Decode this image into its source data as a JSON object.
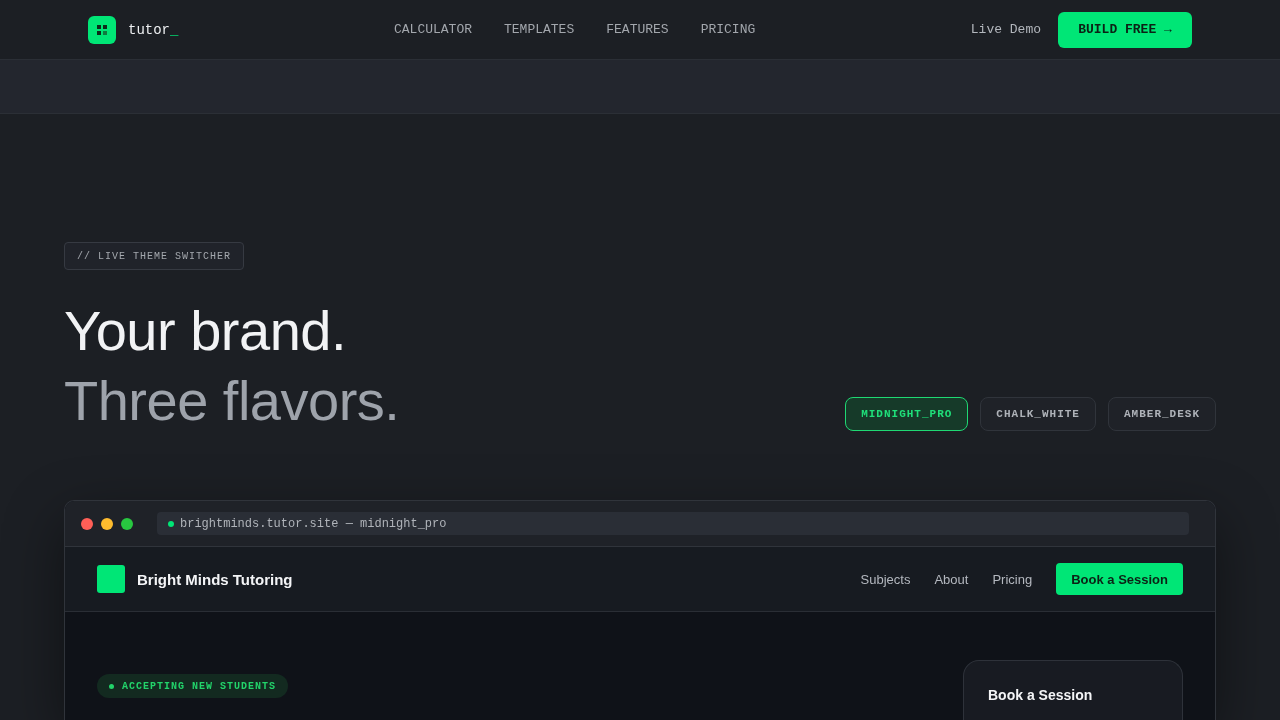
{
  "nav": {
    "brand": {
      "name": "tutor",
      "cursor": "_"
    },
    "links": [
      "CALCULATOR",
      "TEMPLATES",
      "FEATURES",
      "PRICING"
    ],
    "demo_link": "Live Demo",
    "cta": "BUILD FREE →"
  },
  "hero": {
    "eyebrow": "// LIVE THEME SWITCHER",
    "headline": "Your brand.",
    "subheadline": "Three flavors.",
    "themes": [
      {
        "label": "MIDNIGHT_PRO",
        "selected": true
      },
      {
        "label": "CHALK_WHITE",
        "selected": false
      },
      {
        "label": "AMBER_DESK",
        "selected": false
      }
    ]
  },
  "preview": {
    "url": "brightminds.tutor.site — midnight_pro",
    "site": {
      "name": "Bright Minds Tutoring",
      "links": [
        "Subjects",
        "About",
        "Pricing"
      ],
      "cta": "Book a Session",
      "badge": "ACCEPTING NEW STUDENTS",
      "card_title": "Book a Session"
    }
  }
}
